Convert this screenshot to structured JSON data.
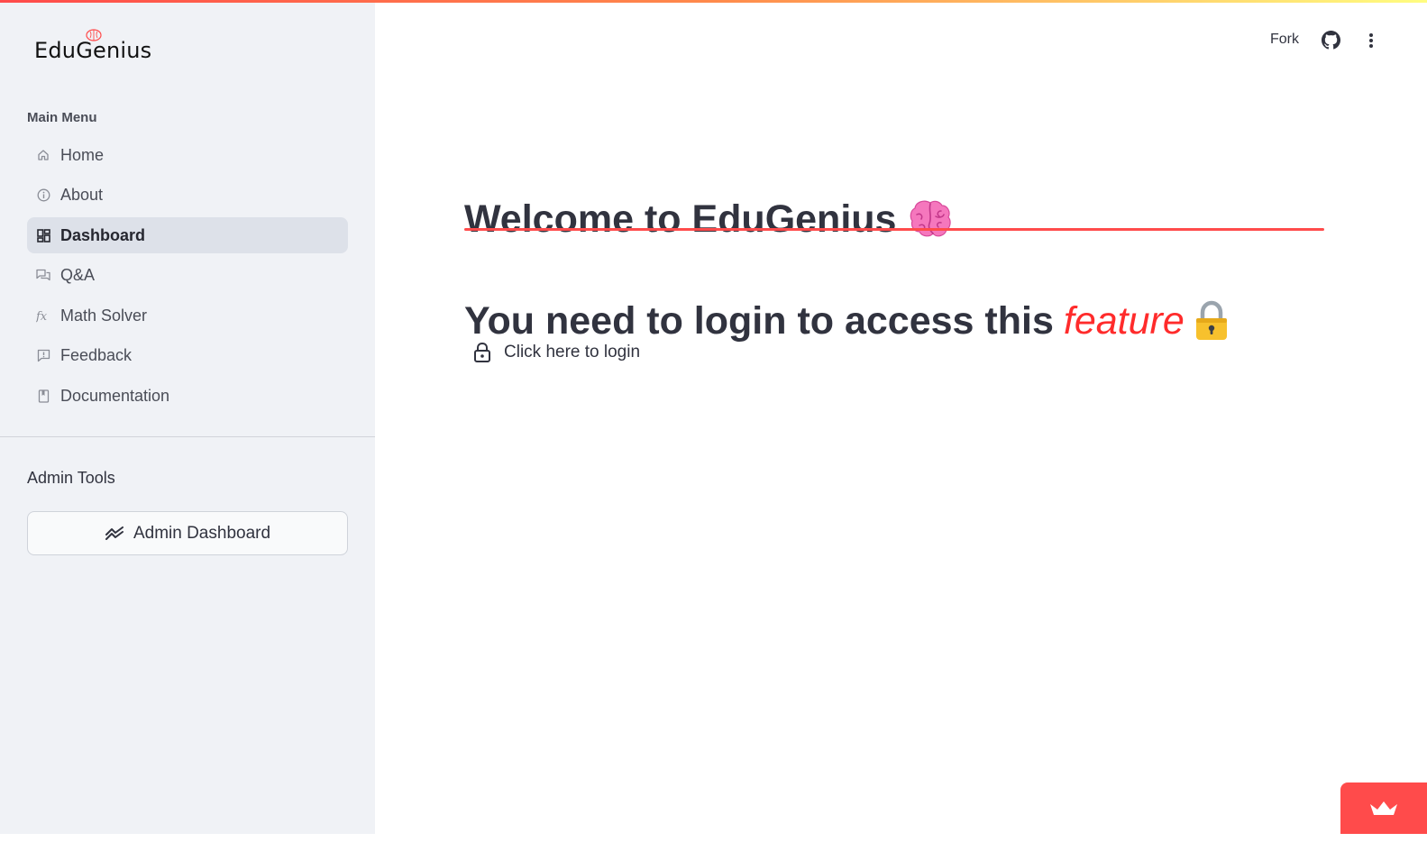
{
  "app": {
    "logo_text": "EduGenius",
    "accent_color": "#ff4b4b"
  },
  "sidebar": {
    "menu_title": "Main Menu",
    "items": [
      {
        "label": "Home",
        "icon": "home-icon",
        "active": false
      },
      {
        "label": "About",
        "icon": "info-icon",
        "active": false
      },
      {
        "label": "Dashboard",
        "icon": "dashboard-icon",
        "active": true
      },
      {
        "label": "Q&A",
        "icon": "chat-icon",
        "active": false
      },
      {
        "label": "Math Solver",
        "icon": "function-icon",
        "active": false
      },
      {
        "label": "Feedback",
        "icon": "feedback-icon",
        "active": false
      },
      {
        "label": "Documentation",
        "icon": "book-icon",
        "active": false
      }
    ],
    "admin_title": "Admin Tools",
    "admin_button": {
      "label": "Admin Dashboard",
      "icon": "chart-line-icon"
    }
  },
  "header": {
    "fork_label": "Fork",
    "github_icon": "github-icon",
    "more_icon": "more-vertical-icon"
  },
  "main": {
    "title": "Welcome to EduGenius",
    "title_emoji": "brain-emoji",
    "subtitle_prefix": "You need to login to access this",
    "subtitle_accent": "feature",
    "subtitle_emoji": "lock-emoji",
    "login_link": {
      "label": "Click here to login",
      "icon": "unlock-icon"
    }
  },
  "footer": {
    "badge_icon": "crown-icon"
  }
}
